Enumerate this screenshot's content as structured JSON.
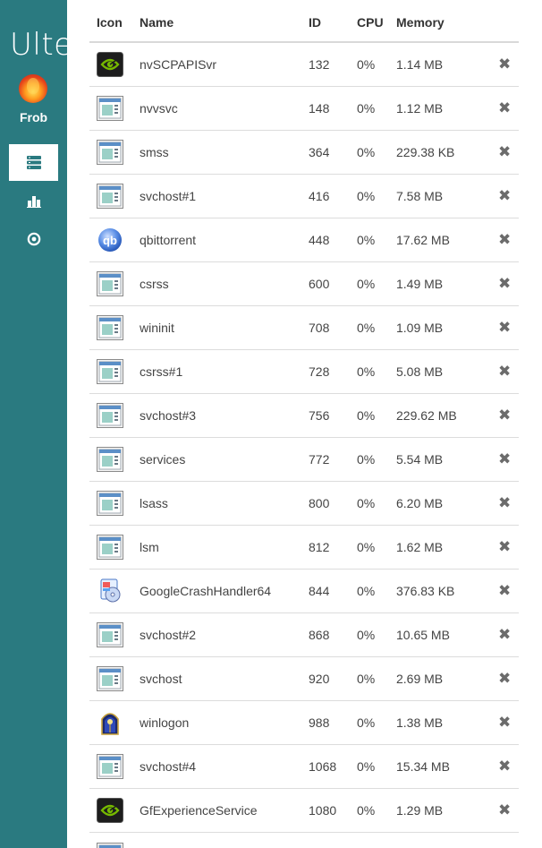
{
  "app": {
    "brand": "Ulte",
    "user": "Frob"
  },
  "nav": [
    {
      "icon": "server-list-icon",
      "active": true
    },
    {
      "icon": "bar-chart-icon",
      "active": false
    },
    {
      "icon": "target-icon",
      "active": false
    }
  ],
  "table": {
    "headers": {
      "icon": "Icon",
      "name": "Name",
      "id": "ID",
      "cpu": "CPU",
      "memory": "Memory"
    },
    "kill_glyph": "✖",
    "rows": [
      {
        "icon": "nvidia-icon",
        "name": "nvSCPAPISvr",
        "id": "132",
        "cpu": "0%",
        "memory": "1.14 MB"
      },
      {
        "icon": "window-app-icon",
        "name": "nvvsvc",
        "id": "148",
        "cpu": "0%",
        "memory": "1.12 MB"
      },
      {
        "icon": "window-app-icon",
        "name": "smss",
        "id": "364",
        "cpu": "0%",
        "memory": "229.38 KB"
      },
      {
        "icon": "window-app-icon",
        "name": "svchost#1",
        "id": "416",
        "cpu": "0%",
        "memory": "7.58 MB"
      },
      {
        "icon": "qbittorrent-icon",
        "name": "qbittorrent",
        "id": "448",
        "cpu": "0%",
        "memory": "17.62 MB"
      },
      {
        "icon": "window-app-icon",
        "name": "csrss",
        "id": "600",
        "cpu": "0%",
        "memory": "1.49 MB"
      },
      {
        "icon": "window-app-icon",
        "name": "wininit",
        "id": "708",
        "cpu": "0%",
        "memory": "1.09 MB"
      },
      {
        "icon": "window-app-icon",
        "name": "csrss#1",
        "id": "728",
        "cpu": "0%",
        "memory": "5.08 MB"
      },
      {
        "icon": "window-app-icon",
        "name": "svchost#3",
        "id": "756",
        "cpu": "0%",
        "memory": "229.62 MB"
      },
      {
        "icon": "window-app-icon",
        "name": "services",
        "id": "772",
        "cpu": "0%",
        "memory": "5.54 MB"
      },
      {
        "icon": "window-app-icon",
        "name": "lsass",
        "id": "800",
        "cpu": "0%",
        "memory": "6.20 MB"
      },
      {
        "icon": "window-app-icon",
        "name": "lsm",
        "id": "812",
        "cpu": "0%",
        "memory": "1.62 MB"
      },
      {
        "icon": "installer-icon",
        "name": "GoogleCrashHandler64",
        "id": "844",
        "cpu": "0%",
        "memory": "376.83 KB"
      },
      {
        "icon": "window-app-icon",
        "name": "svchost#2",
        "id": "868",
        "cpu": "0%",
        "memory": "10.65 MB"
      },
      {
        "icon": "window-app-icon",
        "name": "svchost",
        "id": "920",
        "cpu": "0%",
        "memory": "2.69 MB"
      },
      {
        "icon": "winlogon-icon",
        "name": "winlogon",
        "id": "988",
        "cpu": "0%",
        "memory": "1.38 MB"
      },
      {
        "icon": "window-app-icon",
        "name": "svchost#4",
        "id": "1068",
        "cpu": "0%",
        "memory": "15.34 MB"
      },
      {
        "icon": "nvidia-icon",
        "name": "GfExperienceService",
        "id": "1080",
        "cpu": "0%",
        "memory": "1.29 MB"
      },
      {
        "icon": "window-app-icon",
        "name": "",
        "id": "",
        "cpu": "",
        "memory": ""
      }
    ]
  },
  "colors": {
    "sidebar": "#2a7a80",
    "nvidia_green": "#76b900",
    "qbittorrent_blue": "#3a6fd8"
  }
}
